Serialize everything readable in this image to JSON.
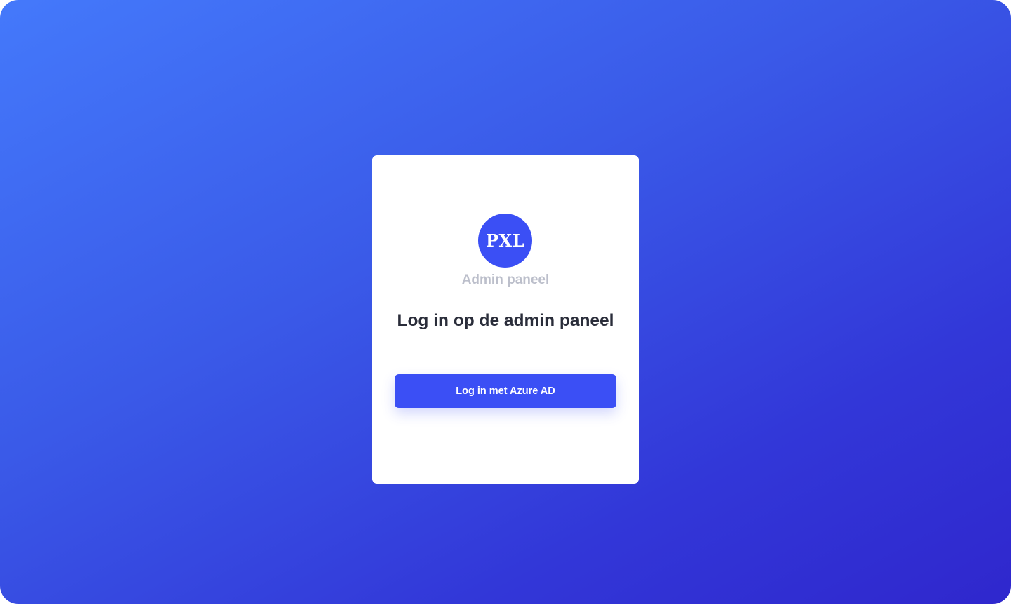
{
  "logo": {
    "text": "PXL"
  },
  "card": {
    "subtitle": "Admin paneel",
    "heading": "Log in op de admin paneel",
    "login_button_label": "Log in met Azure AD"
  },
  "colors": {
    "brand": "#3b4ff5",
    "gradient_start": "#4479fb",
    "gradient_end": "#2f27cd",
    "heading_text": "#2a2d3a",
    "subtitle_text": "#bcbfcb"
  }
}
